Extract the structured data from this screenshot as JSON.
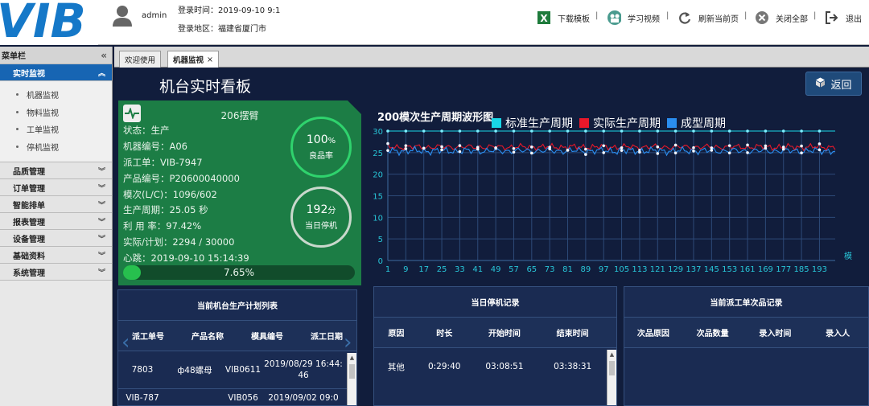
{
  "header": {
    "logo_text": "VIB",
    "username": "admin",
    "login_time": "登录时间：2019-09-10 9:1",
    "login_area": "登录地区：福建省厦门市",
    "actions": [
      {
        "label": "下载模板",
        "icon": "excel-icon"
      },
      {
        "label": "学习视频",
        "icon": "video-icon"
      },
      {
        "label": "刷新当前页",
        "icon": "refresh-icon"
      },
      {
        "label": "关闭全部",
        "icon": "close-all-icon"
      },
      {
        "label": "退出",
        "icon": "logout-icon"
      }
    ],
    "separator": "|"
  },
  "sidebar": {
    "title": "菜单栏",
    "collapse_glyph": "«",
    "groups": [
      {
        "label": "实时监视",
        "active": true,
        "items": [
          "机器监视",
          "物料监视",
          "工单监视",
          "停机监视"
        ]
      },
      {
        "label": "品质管理"
      },
      {
        "label": "订单管理"
      },
      {
        "label": "智能排单"
      },
      {
        "label": "报表管理"
      },
      {
        "label": "设备管理"
      },
      {
        "label": "基础资料"
      },
      {
        "label": "系统管理"
      }
    ]
  },
  "tabs": [
    {
      "label": "欢迎使用"
    },
    {
      "label": "机器监视",
      "close": "×",
      "active": true
    }
  ],
  "page": {
    "title": "机台实时看板",
    "back_label": "返回"
  },
  "machine": {
    "name": "206摆臂",
    "lines": [
      "状态：生产",
      "机器编号：A06",
      "派工单：VIB-7947",
      "产品编号：P20600040000",
      "模次(L/C)：1096/602",
      "生产周期：25.05 秒",
      "利 用 率：97.42%",
      "实际/计划：2294 / 30000",
      "心跳：2019-09-10 15:14:39"
    ],
    "yield_value": "100",
    "yield_unit": "%",
    "yield_label": "良品率",
    "downtime_value": "192",
    "downtime_unit": "分",
    "downtime_label": "当日停机",
    "progress_text": "7.65%",
    "progress_fraction": 0.0765
  },
  "chart_data": {
    "type": "line",
    "title": "200模次生产周期波形图",
    "xlabel": "模",
    "ylim": [
      0,
      30
    ],
    "y_ticks": [
      0,
      5,
      10,
      15,
      20,
      25,
      30
    ],
    "x_ticks": [
      1,
      9,
      17,
      25,
      33,
      41,
      49,
      57,
      65,
      73,
      81,
      89,
      97,
      105,
      113,
      121,
      129,
      137,
      145,
      153,
      161,
      169,
      177,
      185,
      193
    ],
    "x_range": [
      1,
      200
    ],
    "series": [
      {
        "name": "标准生产周期",
        "color": "#19d6e6",
        "constant": 30
      },
      {
        "name": "实际生产周期",
        "color": "#e8182a",
        "mean": 26.3,
        "amplitude": 0.6
      },
      {
        "name": "成型周期",
        "color": "#2a8ef0",
        "mean": 25.4,
        "amplitude": 0.7
      }
    ],
    "grid": true
  },
  "panels": {
    "plan": {
      "title": "当前机台生产计划列表",
      "columns": [
        "派工单号",
        "产品名称",
        "模具编号",
        "派工日期"
      ],
      "rows": [
        [
          "7803",
          "ф48螺母",
          "VIB0611",
          "2019/08/29 16:44:46"
        ],
        [
          "VIB-787",
          "",
          "VIB056",
          "2019/09/02 09:0"
        ]
      ],
      "nav_prev": "‹",
      "nav_next": "›"
    },
    "downtime": {
      "title": "当日停机记录",
      "columns": [
        "原因",
        "时长",
        "开始时间",
        "结束时间"
      ],
      "rows": [
        [
          "其他",
          "0:29:40",
          "03:08:51",
          "03:38:31"
        ]
      ]
    },
    "defects": {
      "title": "当前派工单次品记录",
      "columns": [
        "次品原因",
        "次品数量",
        "录入时间",
        "录入人"
      ],
      "rows": []
    }
  }
}
